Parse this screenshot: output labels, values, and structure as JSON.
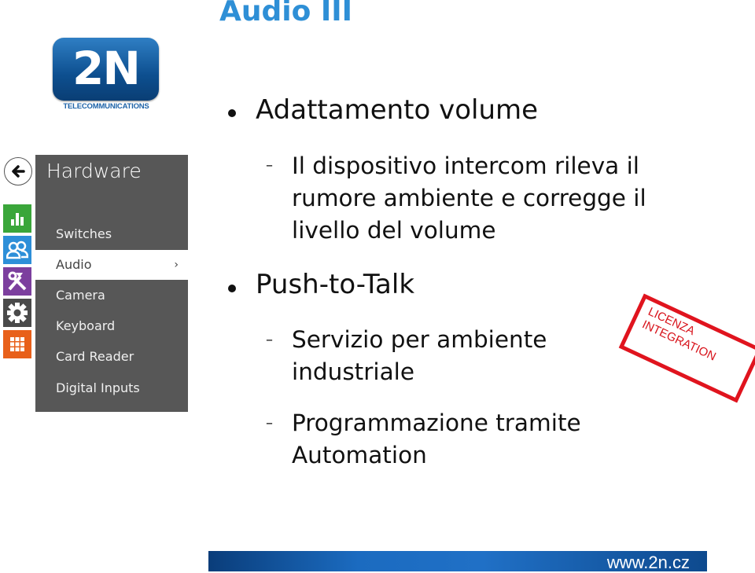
{
  "slide": {
    "title": "Audio III"
  },
  "logo": {
    "mark": "2N",
    "subtitle": "TELECOMMUNICATIONS",
    "color": "#1e63a8"
  },
  "ui_panel": {
    "icons": [
      {
        "name": "back-arrow",
        "color": "#ffffff"
      },
      {
        "name": "status-chart",
        "color": "#3aa63a"
      },
      {
        "name": "users",
        "color": "#2d8fd8"
      },
      {
        "name": "tools",
        "color": "#7c3f9e"
      },
      {
        "name": "settings-gear",
        "color": "#4a4a4a"
      },
      {
        "name": "apps-grid",
        "color": "#e8601a"
      }
    ],
    "header": "Hardware",
    "menu": [
      {
        "label": "Switches",
        "active": false
      },
      {
        "label": "Audio",
        "active": true,
        "chevron": "›"
      },
      {
        "label": "Camera",
        "active": false
      },
      {
        "label": "Keyboard",
        "active": false
      },
      {
        "label": "Card Reader",
        "active": false
      },
      {
        "label": "Digital Inputs",
        "active": false
      }
    ]
  },
  "content": {
    "bullets": [
      {
        "text": "Adattamento volume",
        "sub": [
          {
            "lines": [
              "Il dispositivo intercom rileva il",
              "rumore ambiente e corregge il",
              "livello del volume"
            ]
          }
        ]
      },
      {
        "text": "Push-to-Talk",
        "sub": [
          {
            "lines": [
              "Servizio per ambiente",
              "industriale"
            ]
          },
          {
            "lines": [
              "Programmazione tramite",
              "Automation"
            ]
          }
        ]
      }
    ]
  },
  "stamp": {
    "line1": "LICENZA",
    "line2": "INTEGRATION",
    "color": "#e0141e"
  },
  "footer": {
    "url": "www.2n.cz"
  }
}
